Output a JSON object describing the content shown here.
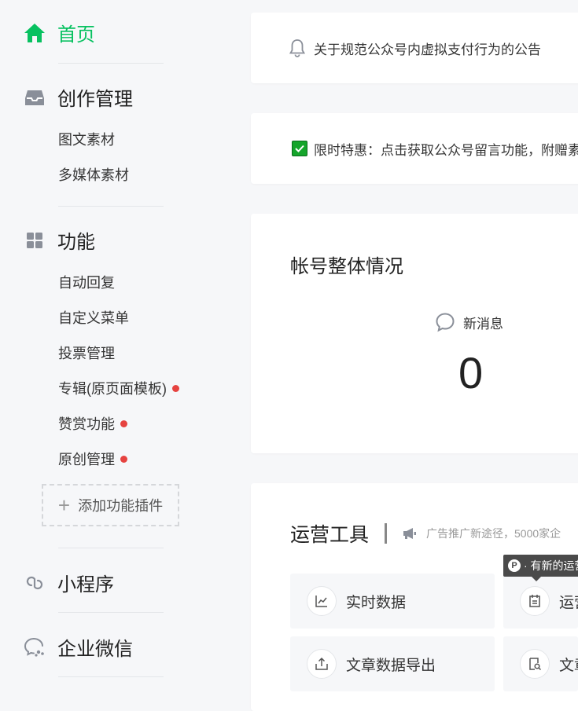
{
  "sidebar": {
    "home": {
      "label": "首页",
      "icon": "home-icon"
    },
    "sections": [
      {
        "label": "创作管理",
        "icon": "inbox-icon",
        "items": [
          "图文素材",
          "多媒体素材"
        ]
      },
      {
        "label": "功能",
        "icon": "grid-icon",
        "items": [
          {
            "label": "自动回复",
            "dot": false
          },
          {
            "label": "自定义菜单",
            "dot": false
          },
          {
            "label": "投票管理",
            "dot": false
          },
          {
            "label": "专辑(原页面模板)",
            "dot": true
          },
          {
            "label": "赞赏功能",
            "dot": true
          },
          {
            "label": "原创管理",
            "dot": true
          }
        ]
      },
      {
        "label": "小程序",
        "icon": "link-icon"
      },
      {
        "label": "企业微信",
        "icon": "wecom-icon"
      }
    ],
    "add_plugin_label": "添加功能插件"
  },
  "notice": {
    "text": "关于规范公众号内虚拟支付行为的公告",
    "icon": "bell-icon"
  },
  "promo": {
    "text": "限时特惠：点击获取公众号留言功能，附赠素",
    "icon": "checkbox-icon"
  },
  "overview": {
    "title": "帐号整体情况",
    "new_messages_label": "新消息",
    "new_messages_count": "0"
  },
  "tools": {
    "title": "运营工具",
    "ad_text": "广告推广新途径，5000家企",
    "tooltip": "· 有新的运营",
    "tooltip_icon_letter": "P",
    "tiles": [
      {
        "label": "实时数据",
        "icon": "chart-line-icon"
      },
      {
        "label": "运营",
        "icon": "calendar-icon"
      },
      {
        "label": "文章数据导出",
        "icon": "export-icon"
      },
      {
        "label": "文章",
        "icon": "doc-search-icon"
      }
    ]
  },
  "colors": {
    "accent": "#07c160",
    "badge": "#e64340",
    "text": "#353535",
    "background": "#f6f7f9"
  }
}
